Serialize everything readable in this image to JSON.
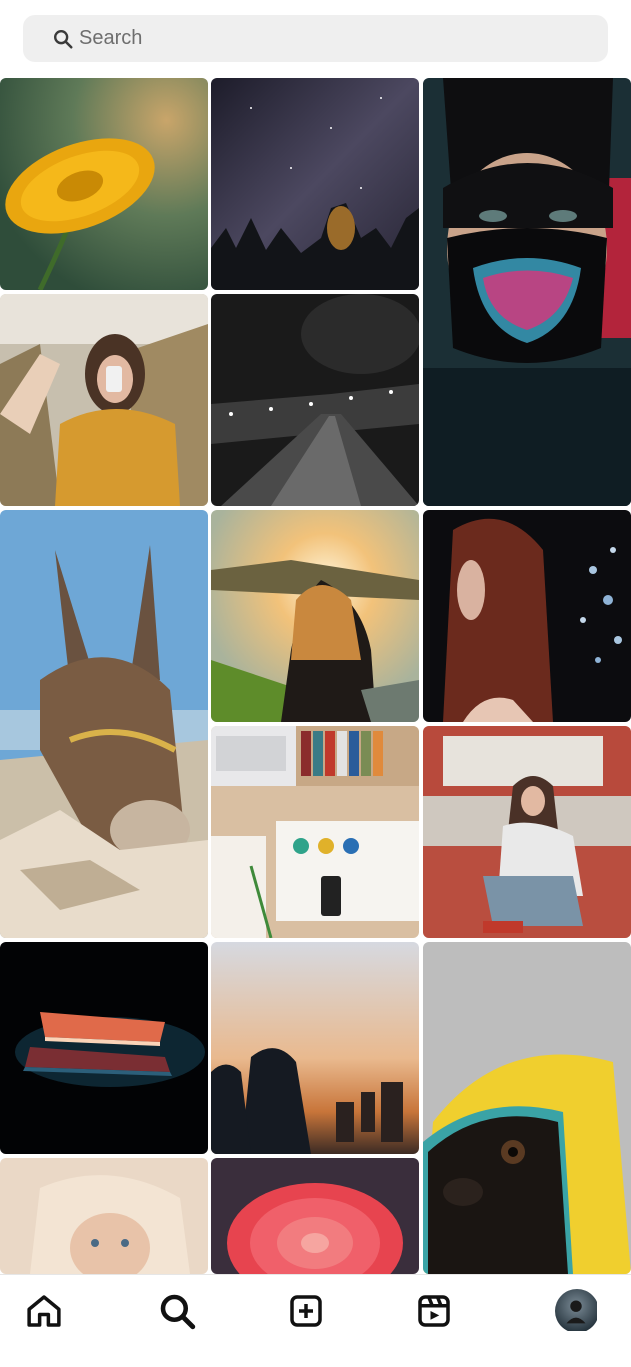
{
  "search": {
    "placeholder": "Search",
    "icon": "search-icon"
  },
  "grid": {
    "tiles": [
      {
        "name": "explore-tile-yellow-flower"
      },
      {
        "name": "explore-tile-milky-way-forest"
      },
      {
        "name": "explore-tile-man-neon-skull-mask"
      },
      {
        "name": "explore-tile-woman-phone-selfie"
      },
      {
        "name": "explore-tile-night-street-bw"
      },
      {
        "name": "explore-tile-donkey"
      },
      {
        "name": "explore-tile-woman-sunset-field"
      },
      {
        "name": "explore-tile-woman-red-hood"
      },
      {
        "name": "explore-tile-desk-flatlay"
      },
      {
        "name": "explore-tile-woman-red-truck"
      },
      {
        "name": "explore-tile-laptop-dark"
      },
      {
        "name": "explore-tile-silhouettes-city-sunset"
      },
      {
        "name": "explore-tile-pug-yellow-hood"
      },
      {
        "name": "explore-tile-baby-veil"
      },
      {
        "name": "explore-tile-pink-dahlia"
      }
    ]
  },
  "nav": {
    "items": [
      {
        "name": "home-icon"
      },
      {
        "name": "search-icon"
      },
      {
        "name": "create-post-icon"
      },
      {
        "name": "reels-icon"
      },
      {
        "name": "profile-avatar"
      }
    ]
  }
}
